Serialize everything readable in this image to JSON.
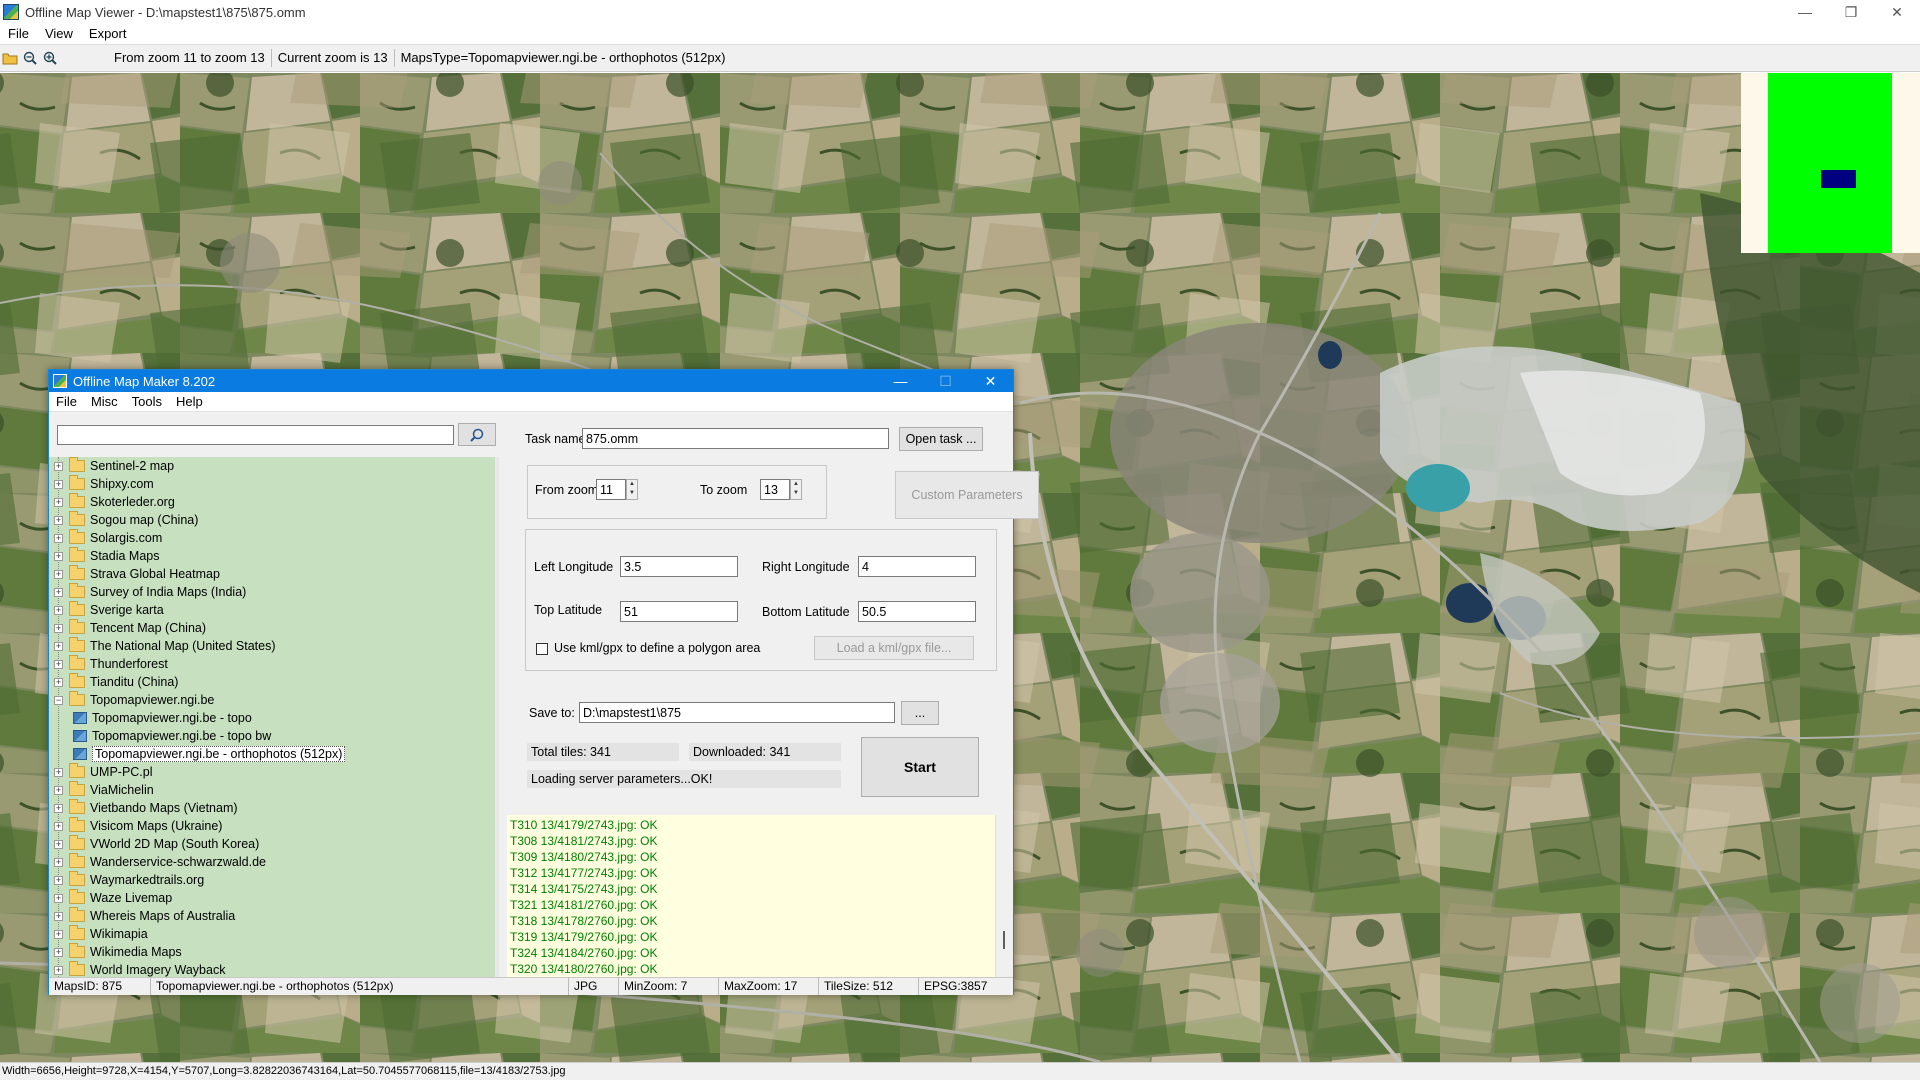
{
  "window": {
    "title": "Offline Map Viewer - D:\\mapstest1\\875\\875.omm",
    "controls": {
      "minimize": "—",
      "restore": "❐",
      "close": "✕"
    }
  },
  "menu": [
    "File",
    "View",
    "Export"
  ],
  "toolbar": {
    "zoom_range": "From zoom 11 to zoom 13",
    "current_zoom": "Current zoom is 13",
    "maps_type": "MapsType=Topomapviewer.ngi.be - orthophotos (512px)"
  },
  "status_bar": "Width=6656,Height=9728,X=4154,Y=5707,Long=3.82822036743164,Lat=50.7045577068115,file=13/4183/2753.jpg",
  "overview_colors": {
    "bg": "#fdf8ea",
    "area": "#00ff00",
    "viewport": "#000080"
  },
  "dialog": {
    "title": "Offline Map Maker 8.202",
    "menu": [
      "File",
      "Misc",
      "Tools",
      "Help"
    ],
    "search": {
      "value": "",
      "icon": "search-icon"
    },
    "tree": [
      {
        "label": "Sentinel-2 map",
        "type": "folder"
      },
      {
        "label": "Shipxy.com",
        "type": "folder"
      },
      {
        "label": "Skoterleder.org",
        "type": "folder"
      },
      {
        "label": "Sogou map (China)",
        "type": "folder"
      },
      {
        "label": "Solargis.com",
        "type": "folder"
      },
      {
        "label": "Stadia Maps",
        "type": "folder"
      },
      {
        "label": "Strava Global Heatmap",
        "type": "folder"
      },
      {
        "label": "Survey of India Maps (India)",
        "type": "folder"
      },
      {
        "label": "Sverige karta",
        "type": "folder"
      },
      {
        "label": "Tencent Map (China)",
        "type": "folder"
      },
      {
        "label": "The National Map (United States)",
        "type": "folder"
      },
      {
        "label": "Thunderforest",
        "type": "folder"
      },
      {
        "label": "Tianditu (China)",
        "type": "folder"
      },
      {
        "label": "Topomapviewer.ngi.be",
        "type": "folder-open"
      },
      {
        "label": "Topomapviewer.ngi.be - topo",
        "type": "map"
      },
      {
        "label": "Topomapviewer.ngi.be - topo bw",
        "type": "map"
      },
      {
        "label": "Topomapviewer.ngi.be - orthophotos (512px)",
        "type": "map",
        "selected": true
      },
      {
        "label": "UMP-PC.pl",
        "type": "folder"
      },
      {
        "label": "ViaMichelin",
        "type": "folder"
      },
      {
        "label": "Vietbando Maps (Vietnam)",
        "type": "folder"
      },
      {
        "label": "Visicom Maps (Ukraine)",
        "type": "folder"
      },
      {
        "label": "VWorld 2D Map (South Korea)",
        "type": "folder"
      },
      {
        "label": "Wanderservice-schwarzwald.de",
        "type": "folder"
      },
      {
        "label": "Waymarkedtrails.org",
        "type": "folder"
      },
      {
        "label": "Waze Livemap",
        "type": "folder"
      },
      {
        "label": "Whereis Maps of Australia",
        "type": "folder"
      },
      {
        "label": "Wikimapia",
        "type": "folder"
      },
      {
        "label": "Wikimedia Maps",
        "type": "folder"
      },
      {
        "label": "World Imagery Wayback",
        "type": "folder"
      }
    ],
    "task": {
      "label": "Task name",
      "value": "875.omm",
      "open_button": "Open task ..."
    },
    "zoom": {
      "from_label": "From zoom",
      "from_value": "11",
      "to_label": "To zoom",
      "to_value": "13",
      "custom_button": "Custom Parameters"
    },
    "coords": {
      "left_lon_label": "Left Longitude",
      "left_lon": "3.5",
      "right_lon_label": "Right Longitude",
      "right_lon": "4",
      "top_lat_label": "Top Latitude",
      "top_lat": "51",
      "bottom_lat_label": "Bottom Latitude",
      "bottom_lat": "50.5",
      "kml_label": "Use kml/gpx to define a polygon area",
      "kml_button": "Load a kml/gpx file..."
    },
    "save": {
      "label": "Save to:",
      "value": "D:\\mapstest1\\875",
      "browse_button": "..."
    },
    "progress": {
      "total": "Total tiles: 341",
      "downloaded": "Downloaded: 341",
      "message": "Loading server parameters...OK!"
    },
    "start_button": "Start",
    "log": [
      "T310 13/4179/2743.jpg: OK",
      "T308 13/4181/2743.jpg: OK",
      "T309 13/4180/2743.jpg: OK",
      "T312 13/4177/2743.jpg: OK",
      "T314 13/4175/2743.jpg: OK",
      "T321 13/4181/2760.jpg: OK",
      "T318 13/4178/2760.jpg: OK",
      "T319 13/4179/2760.jpg: OK",
      "T324 13/4184/2760.jpg: OK",
      "T320 13/4180/2760.jpg: OK"
    ],
    "status": {
      "maps_id": "MapsID: 875",
      "map_name": "Topomapviewer.ngi.be - orthophotos (512px)",
      "format": "JPG",
      "min_zoom": "MinZoom: 7",
      "max_zoom": "MaxZoom: 17",
      "tile_size": "TileSize: 512",
      "epsg": "EPSG:3857"
    }
  }
}
